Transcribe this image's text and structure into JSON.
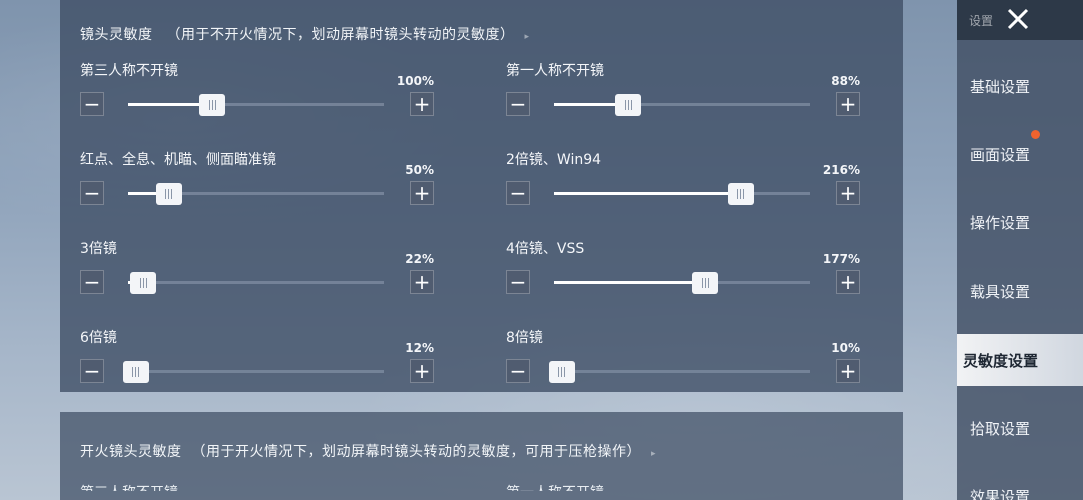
{
  "section1": {
    "title": "镜头灵敏度",
    "hint": "（用于不开火情况下，划动屏幕时镜头转动的灵敏度）"
  },
  "sliders": [
    {
      "label": "第三人称不开镜",
      "percent_text": "100%",
      "fill": 0.33
    },
    {
      "label": "第一人称不开镜",
      "percent_text": "88%",
      "fill": 0.29
    },
    {
      "label": "红点、全息、机瞄、侧面瞄准镜",
      "percent_text": "50%",
      "fill": 0.16
    },
    {
      "label": "2倍镜、Win94",
      "percent_text": "216%",
      "fill": 0.73
    },
    {
      "label": "3倍镜",
      "percent_text": "22%",
      "fill": 0.06
    },
    {
      "label": "4倍镜、VSS",
      "percent_text": "177%",
      "fill": 0.59
    },
    {
      "label": "6倍镜",
      "percent_text": "12%",
      "fill": 0.03
    },
    {
      "label": "8倍镜",
      "percent_text": "10%",
      "fill": 0.03
    }
  ],
  "section2": {
    "title": "开火镜头灵敏度",
    "hint": "（用于开火情况下，划动屏幕时镜头转动的灵敏度，可用于压枪操作）",
    "cut_left": "第三人称不开镜",
    "cut_right": "第一人称不开镜"
  },
  "sidebar": {
    "title": "设置",
    "items": [
      "基础设置",
      "画面设置",
      "操作设置",
      "载具设置",
      "灵敏度设置",
      "拾取设置",
      "效果设置"
    ],
    "active": "灵敏度设置"
  },
  "colors": {
    "accent_dot": "#f0632e",
    "panel": "#3e4d64"
  },
  "icons": {
    "close": "close-icon",
    "minus": "minus-icon",
    "plus": "plus-icon"
  }
}
